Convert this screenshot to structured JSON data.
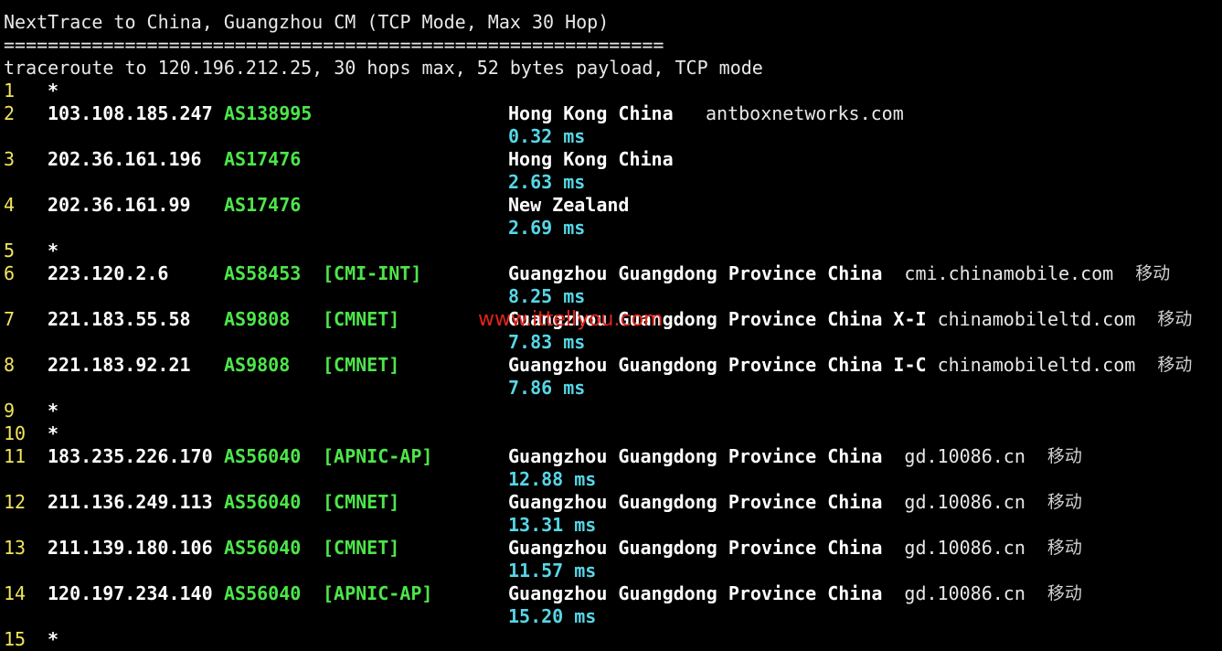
{
  "header": {
    "title": "NextTrace to China, Guangzhou CM (TCP Mode, Max 30 Hop)",
    "separator": "============================================================",
    "traceroute_line": "traceroute to 120.196.212.25, 30 hops max, 52 bytes payload, TCP mode"
  },
  "hops": [
    {
      "hop": "1",
      "star": "*"
    },
    {
      "hop": "2",
      "ip": "103.108.185.247",
      "asn": "AS138995",
      "tag": "",
      "geo": "Hong Kong China",
      "domain": "antboxnetworks.com",
      "isp": "",
      "rtt": "0.32 ms"
    },
    {
      "hop": "3",
      "ip": "202.36.161.196",
      "asn": "AS17476",
      "tag": "",
      "geo": "Hong Kong China",
      "domain": "",
      "isp": "",
      "rtt": "2.63 ms"
    },
    {
      "hop": "4",
      "ip": "202.36.161.99",
      "asn": "AS17476",
      "tag": "",
      "geo": "New Zealand",
      "domain": "",
      "isp": "",
      "rtt": "2.69 ms"
    },
    {
      "hop": "5",
      "star": "*"
    },
    {
      "hop": "6",
      "ip": "223.120.2.6",
      "asn": "AS58453",
      "tag": "[CMI-INT]",
      "geo": "Guangzhou Guangdong Province China",
      "domain": "cmi.chinamobile.com",
      "isp": "移动",
      "rtt": "8.25 ms"
    },
    {
      "hop": "7",
      "ip": "221.183.55.58",
      "asn": "AS9808",
      "tag": "[CMNET]",
      "geo": "Guangzhou Guangdong Province China X-I",
      "domain": "chinamobileltd.com",
      "isp": "移动",
      "rtt": "7.83 ms"
    },
    {
      "hop": "8",
      "ip": "221.183.92.21",
      "asn": "AS9808",
      "tag": "[CMNET]",
      "geo": "Guangzhou Guangdong Province China I-C",
      "domain": "chinamobileltd.com",
      "isp": "移动",
      "rtt": "7.86 ms"
    },
    {
      "hop": "9",
      "star": "*"
    },
    {
      "hop": "10",
      "star": "*"
    },
    {
      "hop": "11",
      "ip": "183.235.226.170",
      "asn": "AS56040",
      "tag": "[APNIC-AP]",
      "geo": "Guangzhou Guangdong Province China",
      "domain": "gd.10086.cn",
      "isp": "移动",
      "rtt": "12.88 ms"
    },
    {
      "hop": "12",
      "ip": "211.136.249.113",
      "asn": "AS56040",
      "tag": "[CMNET]",
      "geo": "Guangzhou Guangdong Province China",
      "domain": "gd.10086.cn",
      "isp": "移动",
      "rtt": "13.31 ms"
    },
    {
      "hop": "13",
      "ip": "211.139.180.106",
      "asn": "AS56040",
      "tag": "[CMNET]",
      "geo": "Guangzhou Guangdong Province China",
      "domain": "gd.10086.cn",
      "isp": "移动",
      "rtt": "11.57 ms"
    },
    {
      "hop": "14",
      "ip": "120.197.234.140",
      "asn": "AS56040",
      "tag": "[APNIC-AP]",
      "geo": "Guangzhou Guangdong Province China",
      "domain": "gd.10086.cn",
      "isp": "移动",
      "rtt": "15.20 ms"
    },
    {
      "hop": "15",
      "star": "*"
    }
  ],
  "watermark": "www.ittellyou.com",
  "colors": {
    "background": "#000000",
    "hop_number": "#f2e65a",
    "asn": "#4de64a",
    "rtt": "#56d6e6",
    "watermark": "#e2231a"
  }
}
